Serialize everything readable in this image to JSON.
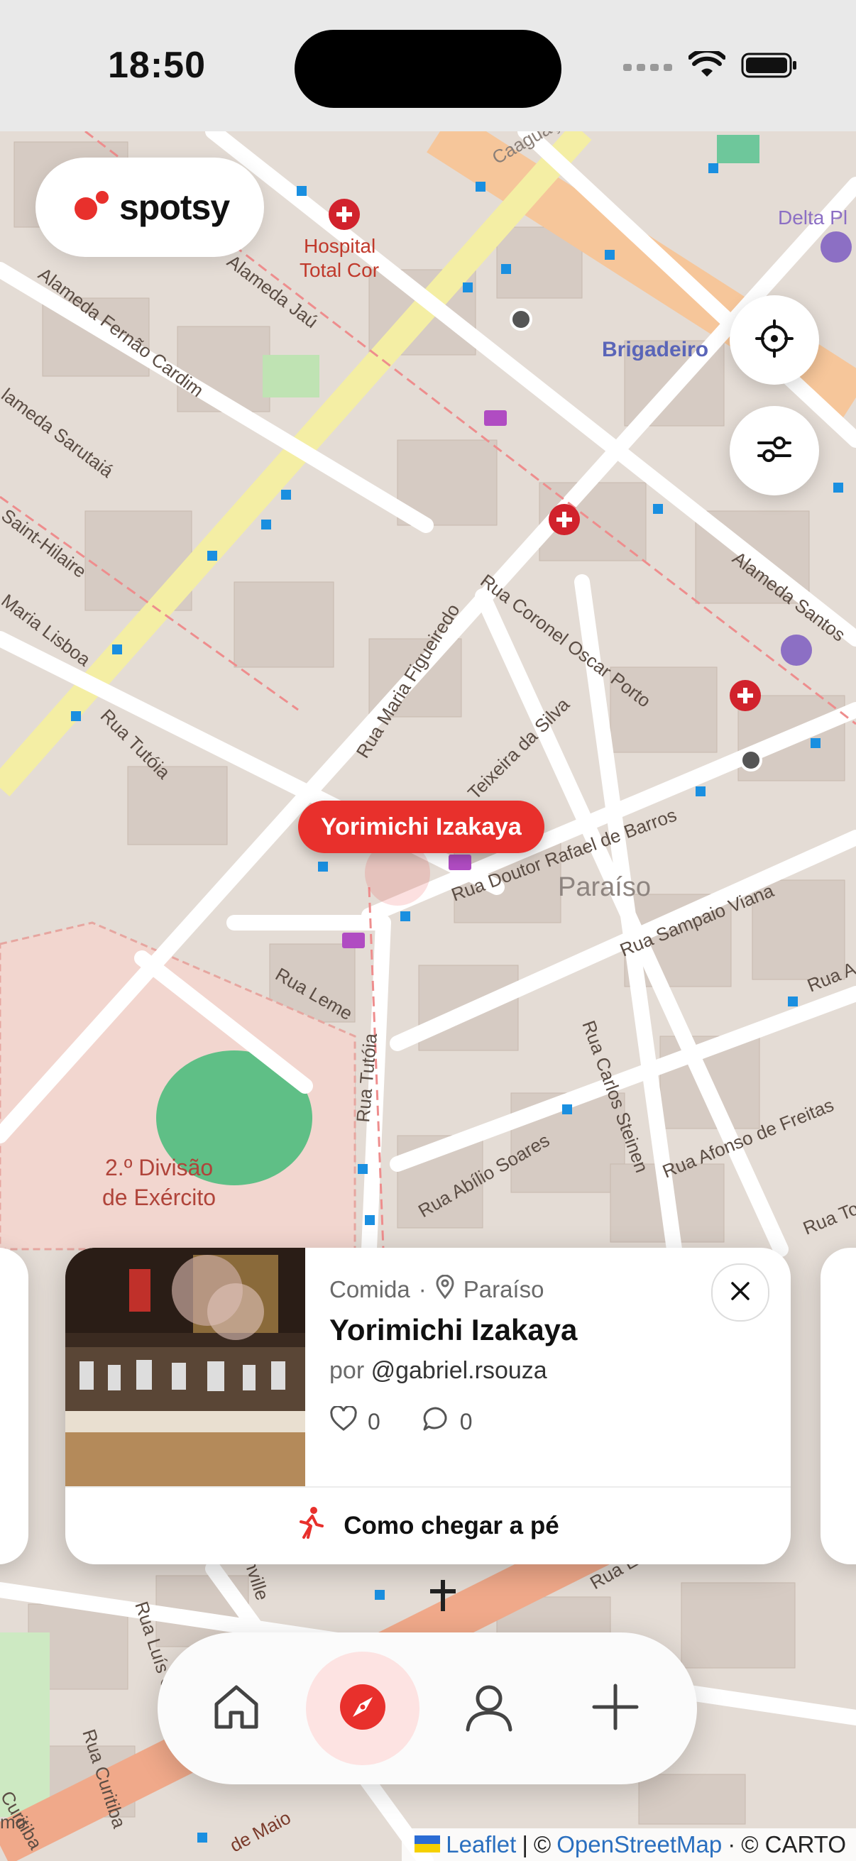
{
  "status_bar": {
    "time": "18:50"
  },
  "brand": {
    "name": "spotsy",
    "accent": "#e8302c"
  },
  "map": {
    "selected_pin_label": "Yorimichi Izakaya",
    "labels": {
      "hospital": "Hospital",
      "hospital2": "Total Cor",
      "brigadeiro": "Brigadeiro",
      "delta": "Delta Pl",
      "paraiso": "Paraíso",
      "divisao1": "2.º Divisão",
      "divisao2": "de Exército",
      "al_fernao": "Alameda Fernão Cardim",
      "al_jau": "Alameda Jaú",
      "al_santos": "Alameda Santos",
      "al_sarutaia": "lameda Sarutaiá",
      "saint": "Saint-Hilaire",
      "maria_lisboa": "Maria Lisboa",
      "tutoia": "Rua Tutóia",
      "tutoia2": "Rua Tutóia",
      "coronel": "Rua Coronel Oscar Porto",
      "maria_fig": "Rua Maria Figueiredo",
      "teixeira": "Teixeira da Silva",
      "rafael": "Rua Doutor Rafael de Barros",
      "sampaio": "Rua Sampaio Viana",
      "leme": "Rua Leme",
      "carlos": "Rua Carlos Steinen",
      "abilio": "Rua Abílio Soares",
      "afonso": "Rua Afonso de Freitas",
      "estela": "Rua Estela",
      "maio": "de Maio",
      "curitiba": "Rua Curitiba",
      "curitiba2": "Curitiba",
      "luis": "Rua Luís Góis",
      "ville": "nville",
      "mo": "mo",
      "ua_a": "Rua A",
      "ua_to": "Rua To",
      "jacu": "Caaguaçu"
    }
  },
  "controls": {
    "locate_icon": "crosshair-icon",
    "filter_icon": "sliders-icon"
  },
  "card": {
    "category": "Comida",
    "separator": "·",
    "neighborhood": "Paraíso",
    "title": "Yorimichi Izakaya",
    "by_prefix": "por",
    "author": "@gabriel.rsouza",
    "likes": "0",
    "comments": "0",
    "walk_label": "Como chegar a pé"
  },
  "tabbar": {
    "items": [
      {
        "name": "home",
        "icon": "home-icon"
      },
      {
        "name": "explore",
        "icon": "compass-icon",
        "active": true
      },
      {
        "name": "profile",
        "icon": "user-icon"
      },
      {
        "name": "add",
        "icon": "plus-icon"
      }
    ]
  },
  "attribution": {
    "leaflet": "Leaflet",
    "sep1": "|",
    "copy1": "©",
    "osm": "OpenStreetMap",
    "sep2": "·",
    "carto": "© CARTO"
  }
}
